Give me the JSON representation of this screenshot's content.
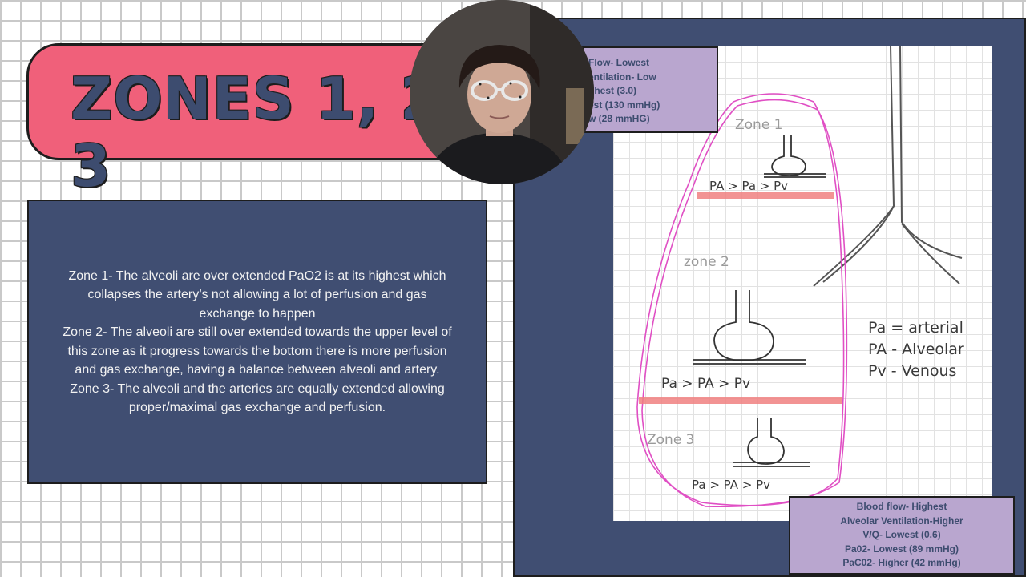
{
  "title": "ZONES 1, 2, 3",
  "description": [
    "Zone 1- The alveoli are over extended PaO2 is at its highest which",
    "collapses the artery’s not allowing a lot of perfusion and gas",
    "exchange to happen",
    "Zone 2- The alveoli are still over extended towards the upper level of",
    "this zone as it progress towards the bottom there is more perfusion",
    "and gas exchange, having a balance between alveoli and artery.",
    "Zone 3- The alveoli and the arteries are equally extended allowing",
    "proper/maximal gas exchange and perfusion."
  ],
  "info_top": [
    "Flow- Lowest",
    "entilation- Low",
    "ghest (3.0)",
    "est (130 mmHg)",
    "w (28 mmHG)"
  ],
  "info_bottom": [
    "Blood flow- Highest",
    "Alveolar Ventilation-Higher",
    "V/Q- Lowest (0.6)",
    "Pa02- Lowest (89 mmHg)",
    "PaC02- Higher (42 mmHg)"
  ],
  "sketch": {
    "zone1_label": "Zone 1",
    "zone2_label": "zone 2",
    "zone3_label": "Zone 3",
    "zone1_eq": "PA > Pa > Pv",
    "zone2_eq": "Pa > PA > Pv",
    "zone3_eq": "Pa > PA > Pv",
    "legend": [
      "Pa = arterial",
      "PA - Alveolar",
      "Pv - Venous"
    ]
  },
  "colors": {
    "banner": "#f0607a",
    "title_text": "#3d4c6f",
    "navy": "#404e72",
    "lavender": "#b9a6cf",
    "lung_outline": "#e04fc4",
    "zone_band": "#f08080"
  },
  "webcam": {
    "icon": "webcam-presenter"
  }
}
